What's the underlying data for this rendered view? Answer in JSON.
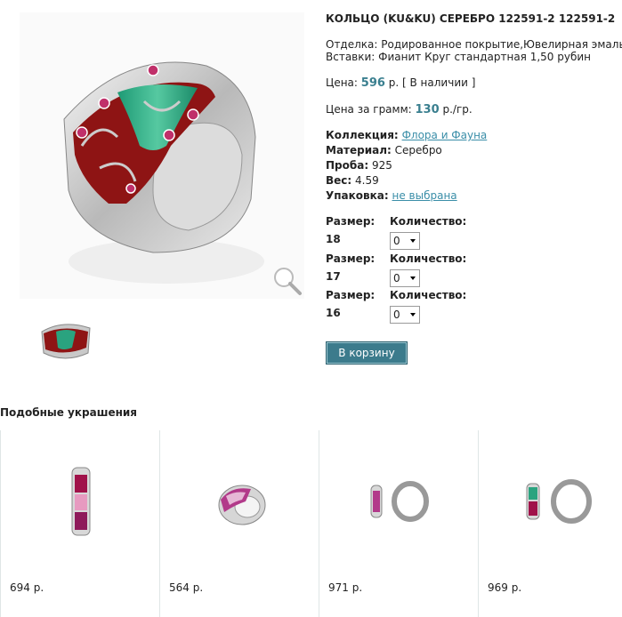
{
  "product": {
    "title": "КОЛЬЦО (KU&KU) СЕРЕБРО 122591-2 122591-2",
    "finish_line": "Отделка: Родированное покрытие,Ювелирная эмаль",
    "inserts_line": "Вставки: Фианит Круг стандартная 1,50 рубин",
    "price_label": "Цена:",
    "price_value": "596",
    "price_unit": "р.",
    "stock": "[ В наличии ]",
    "gram_label": "Цена за грамм:",
    "gram_value": "130",
    "gram_unit": "р./гр.",
    "collection_label": "Коллекция:",
    "collection_value": "Флора и Фауна",
    "material_label": "Материал:",
    "material_value": "Серебро",
    "probe_label": "Проба:",
    "probe_value": "925",
    "weight_label": "Вес:",
    "weight_value": "4.59",
    "package_label": "Упаковка:",
    "package_value": "не выбрана"
  },
  "sizes": [
    {
      "label": "Размер:",
      "value": "18",
      "qty_label": "Количество:",
      "qty": "0"
    },
    {
      "label": "Размер:",
      "value": "17",
      "qty_label": "Количество:",
      "qty": "0"
    },
    {
      "label": "Размер:",
      "value": "16",
      "qty_label": "Количество:",
      "qty": "0"
    }
  ],
  "cart_button": "В корзину",
  "similar": {
    "title": "Подобные украшения",
    "items": [
      {
        "price": "694 р.",
        "kind": "pendant"
      },
      {
        "price": "564 р.",
        "kind": "ring"
      },
      {
        "price": "971 р.",
        "kind": "earrings"
      },
      {
        "price": "969 р.",
        "kind": "earrings"
      }
    ]
  },
  "icons": {
    "zoom": "magnifier-icon"
  },
  "colors": {
    "accent": "#3c7b8c",
    "link": "#3a8ea8",
    "price": "#3a7f8f",
    "enamel_red": "#8e1414",
    "enamel_green": "#2aa37f"
  }
}
